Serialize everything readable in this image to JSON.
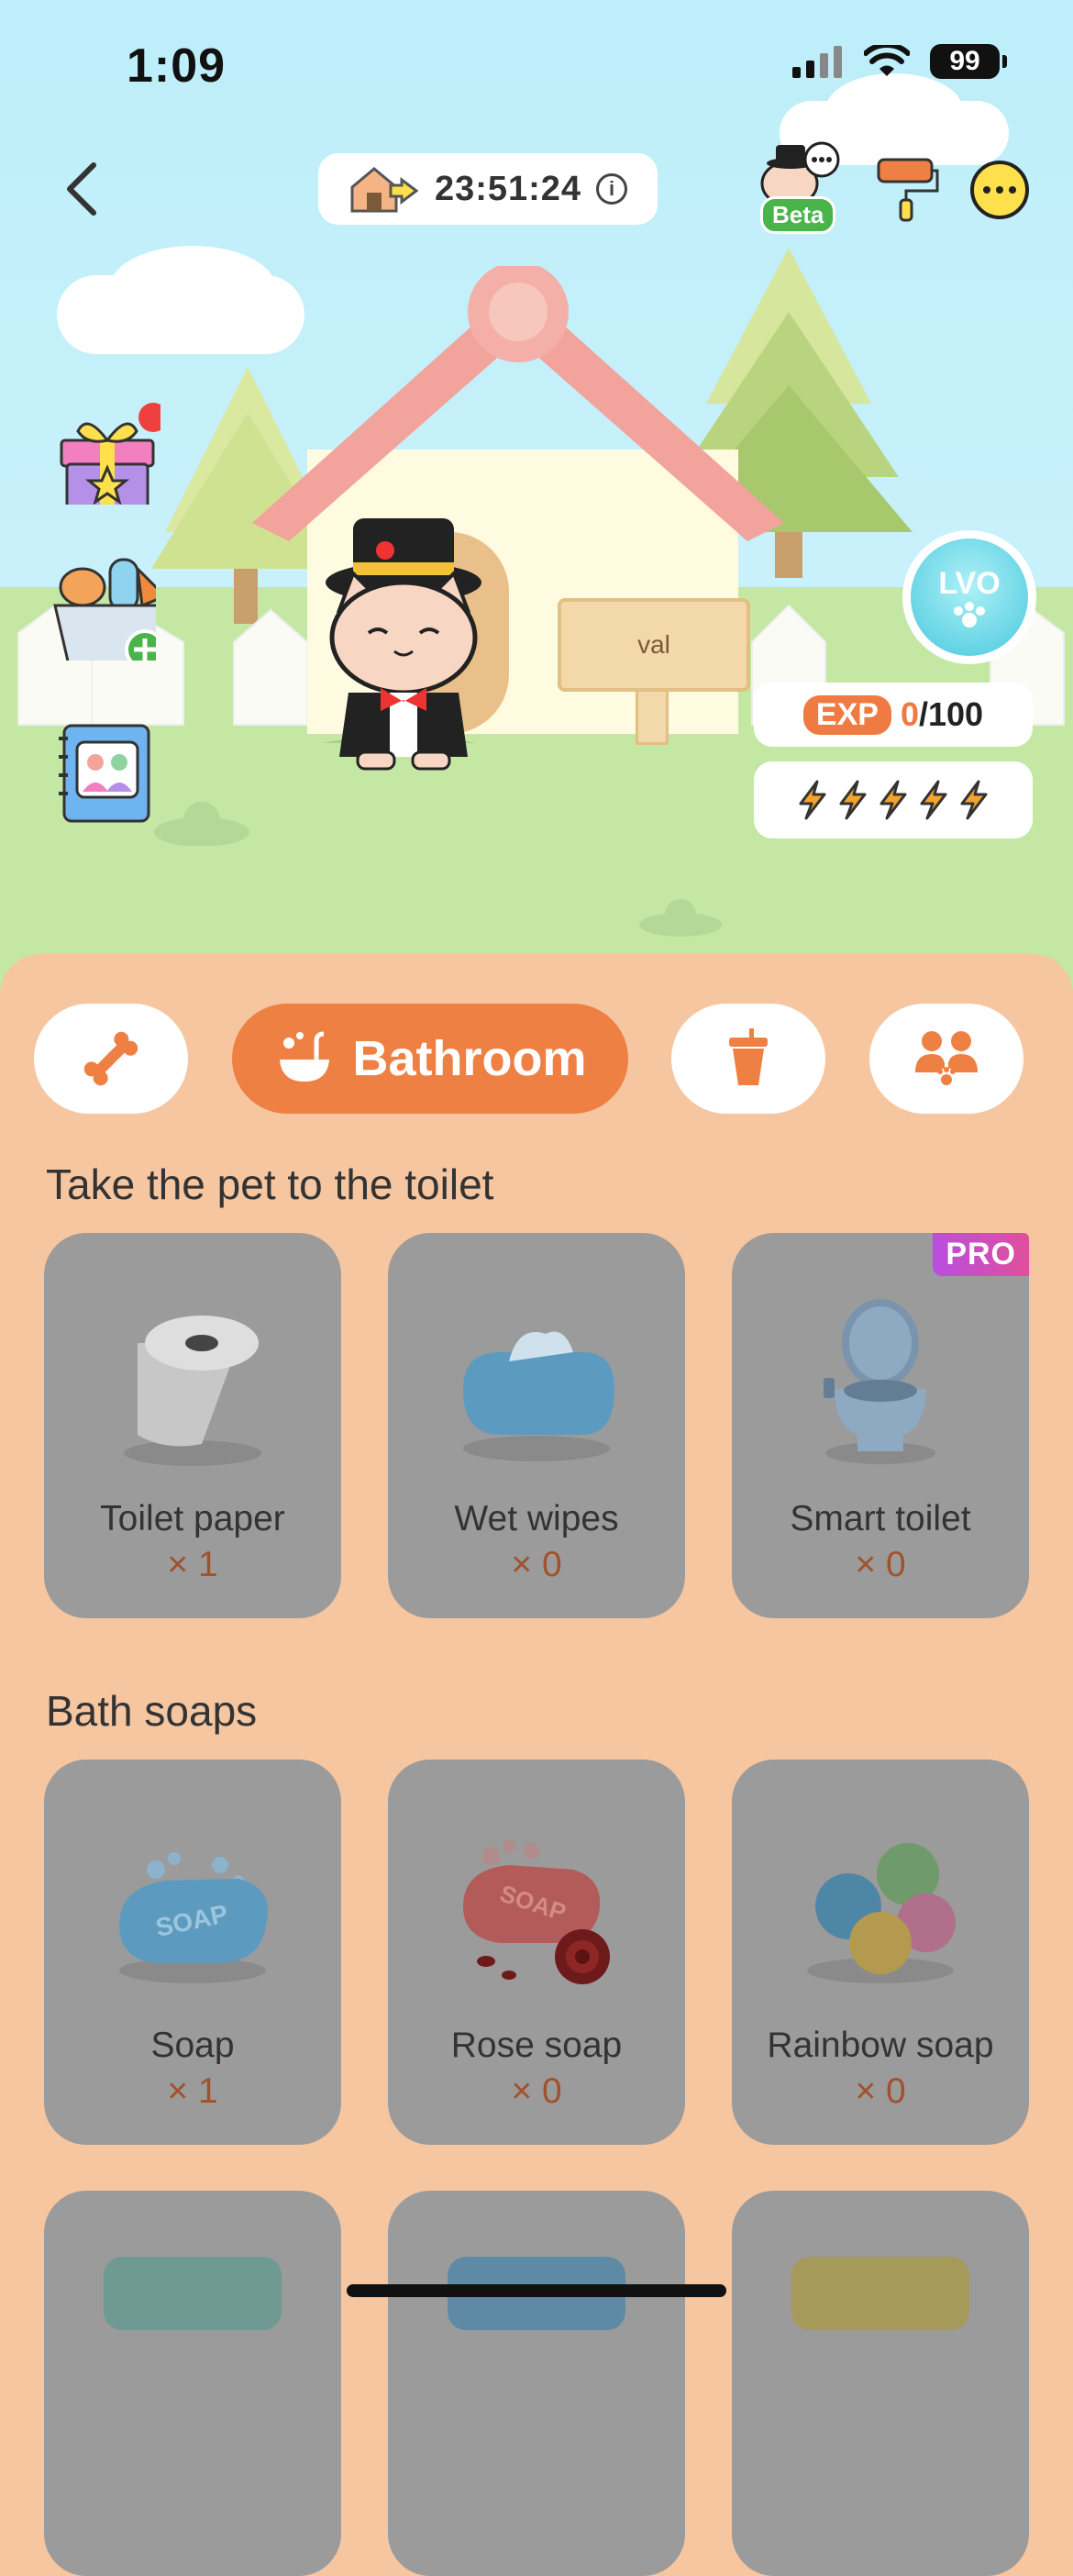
{
  "status_bar": {
    "time": "1:09",
    "battery": "99"
  },
  "header": {
    "timer": "23:51:24",
    "beta_label": "Beta"
  },
  "pet_house": {
    "sign_text": "val"
  },
  "level": {
    "badge_text": "LVO"
  },
  "stats": {
    "exp_label": "EXP",
    "exp_current": "0",
    "exp_max": "/100",
    "energy_bolts": 5
  },
  "tabs": [
    {
      "id": "food",
      "icon": "bone-icon",
      "label": ""
    },
    {
      "id": "bathroom",
      "icon": "bathtub-icon",
      "label": "Bathroom",
      "active": true
    },
    {
      "id": "drink",
      "icon": "cup-icon",
      "label": ""
    },
    {
      "id": "social",
      "icon": "family-paw-icon",
      "label": ""
    }
  ],
  "sections": [
    {
      "title": "Take the pet to the toilet",
      "items": [
        {
          "name": "Toilet paper",
          "qty": "× 1",
          "icon": "toilet-paper-icon"
        },
        {
          "name": "Wet wipes",
          "qty": "× 0",
          "icon": "wet-wipes-icon"
        },
        {
          "name": "Smart toilet",
          "qty": "× 0",
          "icon": "toilet-icon",
          "badge": "PRO"
        }
      ]
    },
    {
      "title": "Bath soaps",
      "items": [
        {
          "name": "Soap",
          "qty": "× 1",
          "icon": "soap-icon",
          "art_text": "SOAP"
        },
        {
          "name": "Rose soap",
          "qty": "× 0",
          "icon": "rose-soap-icon",
          "art_text": "SOAP"
        },
        {
          "name": "Rainbow soap",
          "qty": "× 0",
          "icon": "bath-bombs-icon"
        }
      ]
    }
  ],
  "colors": {
    "accent": "#ef8044",
    "panel": "#f6c6a0",
    "card": "#9b9b9b",
    "qty": "#a0522d"
  }
}
